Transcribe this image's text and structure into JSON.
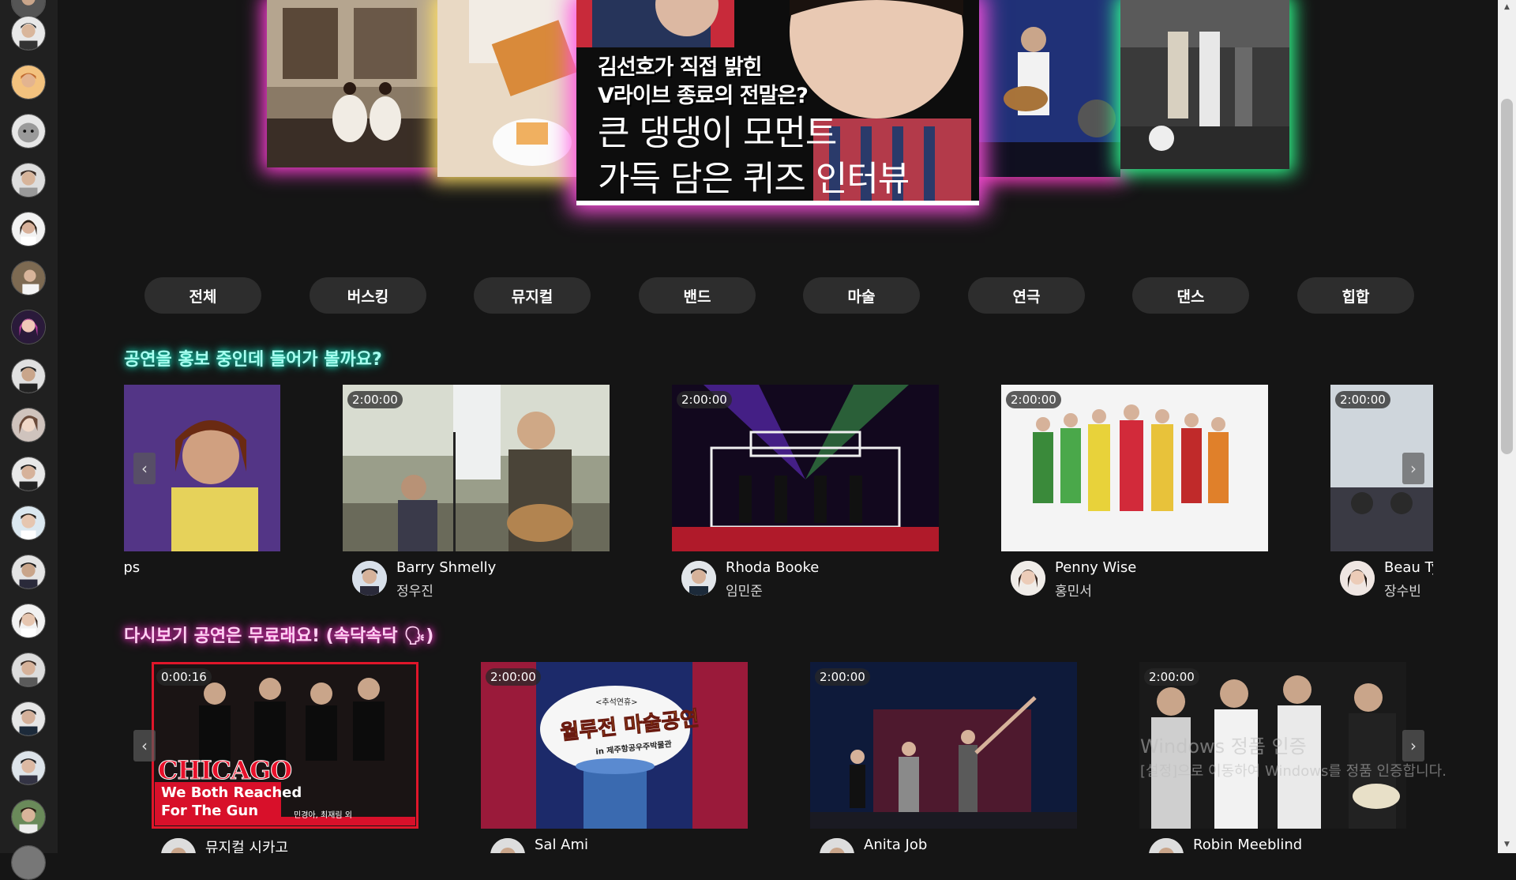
{
  "hero": {
    "main_card": {
      "line1": "김선호가 직접 밝힌",
      "line2": "V라이브 종료의 전말은?",
      "line3": "큰 댕댕이 모먼트",
      "line4": "가득 담은 퀴즈 인터뷰"
    },
    "glow_colors": [
      "#ff40d8",
      "#ffe066",
      "#ff40c8",
      "#30ff90",
      "#ff50e0"
    ]
  },
  "categories": [
    "전체",
    "버스킹",
    "뮤지컬",
    "밴드",
    "마술",
    "연극",
    "댄스",
    "힙합"
  ],
  "promo_section": {
    "title": "공연을 홍보 중인데 들어가 볼까요?",
    "cards": [
      {
        "duration": "",
        "name": "Jazzy Arps",
        "sub": ""
      },
      {
        "duration": "2:00:00",
        "name": "Barry Shmelly",
        "sub": "정우진"
      },
      {
        "duration": "2:00:00",
        "name": "Rhoda Booke",
        "sub": "임민준"
      },
      {
        "duration": "2:00:00",
        "name": "Penny Wise",
        "sub": "홍민서"
      },
      {
        "duration": "2:00:00",
        "name": "Beau Tye",
        "sub": "장수빈"
      }
    ]
  },
  "replay_section": {
    "title": "다시보기 공연은 무료래요! (속닥속닥 🗣)",
    "cards": [
      {
        "duration": "0:00:16",
        "name": "뮤지컬 시카고",
        "poster_title": "CHICAGO",
        "poster_sub1": "We Both Reached",
        "poster_sub2": "For The Gun",
        "poster_cast": "민경아, 최재림 외"
      },
      {
        "duration": "2:00:00",
        "name": "Sal Ami",
        "poster_badge": "<추석연휴>",
        "poster_title": "월루전 마술공연",
        "poster_sub": "in 제주항공우주박물관"
      },
      {
        "duration": "2:00:00",
        "name": "Anita Job"
      },
      {
        "duration": "2:00:00",
        "name": "Robin Meeblind"
      }
    ]
  },
  "arrows": {
    "left": "‹",
    "right": "›"
  },
  "scrollbar": {
    "up": "▲",
    "down": "▼"
  },
  "watermark": {
    "line1": "Windows 정품 인증",
    "line2": "[설정]으로 이동하여 Windows를 정품 인증합니다."
  },
  "colors": {
    "promo_glow": "#19e0c0",
    "replay_glow": "#ff3ad0",
    "background": "#151515",
    "pill": "#2d2d2d"
  }
}
